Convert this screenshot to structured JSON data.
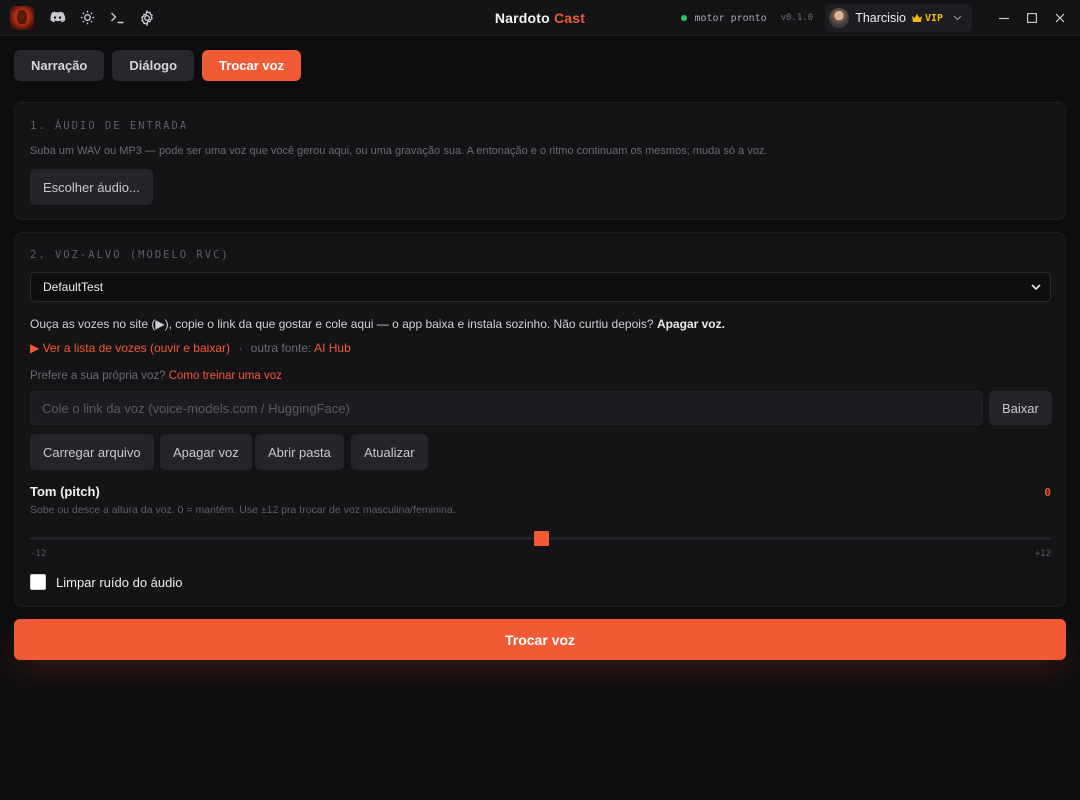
{
  "app": {
    "title_part1": "Nardoto",
    "title_part2": "Cast",
    "engine_status": "motor pronto",
    "version": "v0.1.0",
    "user_name": "Tharcisio",
    "vip_label": "VIP",
    "accent_color": "#f05a34",
    "status_color": "#2ec460"
  },
  "titlebar_icons": [
    "app-logo",
    "discord-icon",
    "sun-icon",
    "terminal-icon",
    "gear-icon"
  ],
  "tabs": [
    {
      "label": "Narração",
      "active": false
    },
    {
      "label": "Diálogo",
      "active": false
    },
    {
      "label": "Trocar voz",
      "active": true
    }
  ],
  "section1": {
    "title": "1. ÁUDIO DE ENTRADA",
    "description": "Suba um WAV ou MP3 — pode ser uma voz que você gerou aqui, ou uma gravação sua. A entonação e o ritmo continuam os mesmos; muda só a voz.",
    "choose_button": "Escolher áudio..."
  },
  "section2": {
    "title": "2. VOZ-ALVO (MODELO RVC)",
    "selected_model": "DefaultTest",
    "info_text": "Ouça as vozes no site (▶), copie o link da que gostar e cole aqui — o app baixa e instala sozinho. Não curtiu depois?",
    "info_bold": "Apagar voz.",
    "voices_link": "▶ Ver a lista de vozes (ouvir e baixar)",
    "separator": "·",
    "other_source_label": "outra fonte:",
    "other_source_link": "AI Hub",
    "own_voice_text": "Prefere a sua própria voz?",
    "train_link": "Como treinar uma voz",
    "url_placeholder": "Cole o link da voz (voice-models.com / HuggingFace)",
    "download_button": "Baixar",
    "actions": [
      "Carregar arquivo",
      "Apagar voz",
      "Abrir pasta",
      "Atualizar"
    ],
    "pitch_label": "Tom (pitch)",
    "pitch_value": "0",
    "pitch_hint": "Sobe ou desce a altura da voz. 0 = mantém. Use ±12 pra trocar de voz masculina/feminina.",
    "pitch_min": "-12",
    "pitch_max": "+12",
    "pitch_position": 0.5,
    "denoise_label": "Limpar ruído do áudio",
    "denoise_checked": false
  },
  "cta_label": "Trocar voz"
}
